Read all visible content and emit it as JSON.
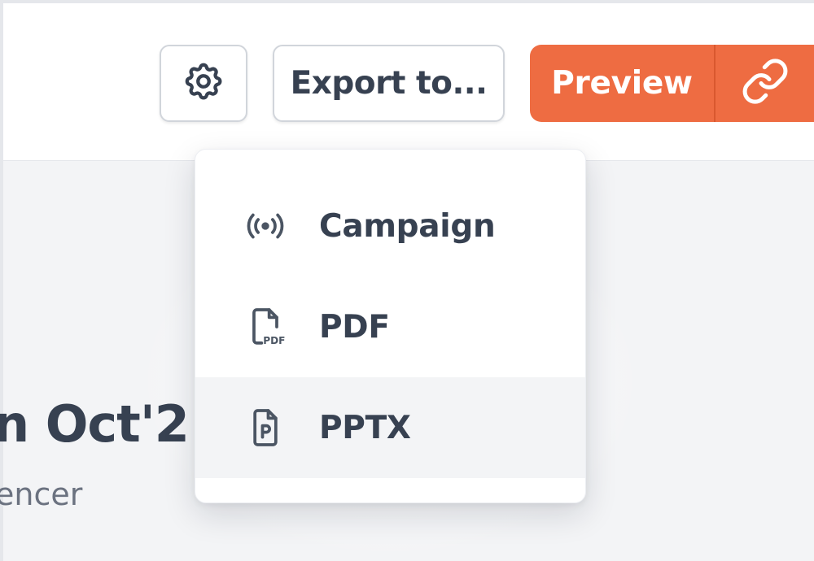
{
  "toolbar": {
    "settings_icon": "gear-icon",
    "export_label": "Export to...",
    "preview_label": "Preview",
    "link_icon": "link-icon"
  },
  "export_menu": {
    "items": [
      {
        "label": "Campaign",
        "icon": "broadcast-icon"
      },
      {
        "label": "PDF",
        "icon": "pdf-file-icon"
      },
      {
        "label": "PPTX",
        "icon": "pptx-file-icon",
        "highlighted": true
      }
    ]
  },
  "document": {
    "title_fragment": "n Oct'2",
    "subtitle_fragment": "encer"
  },
  "colors": {
    "accent": "#ee6c42",
    "text": "#374151",
    "muted_text": "#6b7280",
    "canvas_bg": "#f3f4f6"
  }
}
